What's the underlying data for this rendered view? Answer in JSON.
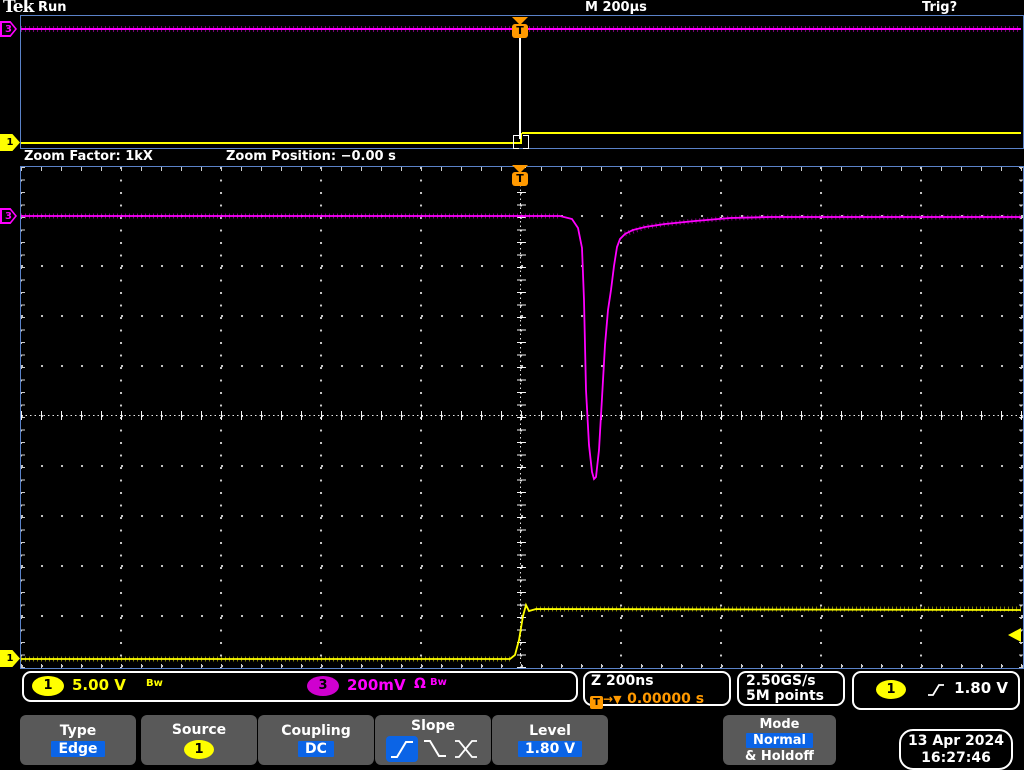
{
  "header": {
    "logo": "Tek",
    "acq_status": "Run",
    "horizontal_scale": "M 200µs",
    "trigger_status": "Trig?"
  },
  "zoom_bar": {
    "factor_label": "Zoom Factor: 1kX",
    "position_label": "Zoom Position: −0.00 s"
  },
  "badges": {
    "ch1": "1",
    "ch3": "3",
    "trigger": "T"
  },
  "readouts": {
    "ch1": {
      "badge": "1",
      "scale": "5.00 V",
      "bw": "Bw"
    },
    "ch3": {
      "badge": "3",
      "scale": "200mV",
      "impedance": "Ω",
      "bw": "Bw"
    },
    "zoom": {
      "scale": "Z 200ns",
      "t": "T",
      "arrow": "→",
      "marker": "▼",
      "position": "0.00000 s"
    },
    "acquisition": {
      "sample_rate": "2.50GS/s",
      "record_length": "5M points"
    },
    "trigger": {
      "badge": "1",
      "level": "1.80 V"
    }
  },
  "menu": {
    "type": {
      "label": "Type",
      "value": "Edge"
    },
    "source": {
      "label": "Source",
      "value": "1"
    },
    "coupling": {
      "label": "Coupling",
      "value": "DC"
    },
    "slope": {
      "label": "Slope"
    },
    "level": {
      "label": "Level",
      "value": "1.80 V"
    },
    "mode": {
      "label": "Mode",
      "value": "Normal",
      "value2": "& Holdoff"
    },
    "datetime": {
      "date": "13 Apr 2024",
      "time": "16:27:46"
    }
  },
  "waveforms": {
    "ch1": {
      "color": "#ffff00",
      "scale": "5.00 V/div",
      "shape": "low level, rising step at trigger point, then flat high with noise"
    },
    "ch3": {
      "color": "#ff00ff",
      "scale": "200mV/div",
      "shape": "flat baseline with noise, sharp negative glitch of ~5.3 divisions shortly after trigger, slow recovery"
    }
  },
  "colors": {
    "background": "#000000",
    "graticule_border": "#5a82c8",
    "trace_ch1": "#ffff00",
    "trace_ch3": "#ff00ff",
    "trigger_orange": "#ff9900",
    "menu_button": "#595959",
    "highlight_blue": "#0b64e6"
  }
}
